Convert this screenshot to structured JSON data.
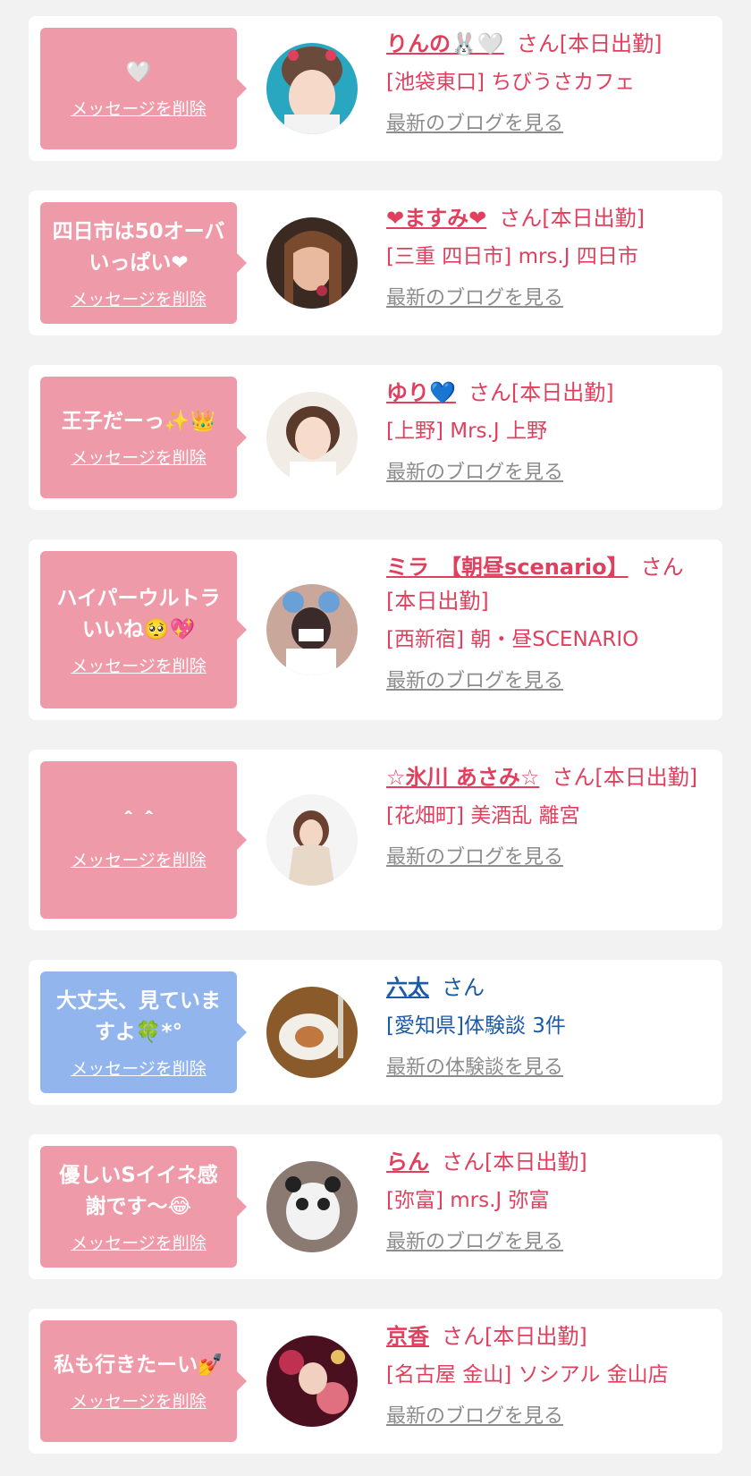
{
  "cards": [
    {
      "message": "🤍",
      "delete_label": "メッセージを削除",
      "name": "りんの🐰🤍",
      "suffix": "さん[本日出勤]",
      "shop": "[池袋東口] ちびうさカフェ",
      "blog_link": "最新のブログを見る"
    },
    {
      "message": "四日市は50オーバ\nいっぱい❤",
      "delete_label": "メッセージを削除",
      "name": "❤ますみ❤",
      "suffix": "さん[本日出勤]",
      "shop": "[三重 四日市] mrs.J 四日市",
      "blog_link": "最新のブログを見る"
    },
    {
      "message": "王子だーっ✨👑",
      "delete_label": "メッセージを削除",
      "name": "ゆり💙",
      "suffix": "さん[本日出勤]",
      "shop": "[上野] Mrs.J 上野",
      "blog_link": "最新のブログを見る"
    },
    {
      "message": "ハイパーウルトラ\nいいね🥺💖",
      "delete_label": "メッセージを削除",
      "name": "ミラ　【朝昼scenario】",
      "suffix": "さん[本日出勤]",
      "shop": "[西新宿] 朝・昼SCENARIO",
      "blog_link": "最新のブログを見る"
    },
    {
      "message": "＾＾",
      "delete_label": "メッセージを削除",
      "name": "☆氷川 あさみ☆",
      "suffix": "さん[本日出勤]",
      "shop": "[花畑町] 美酒乱 離宮",
      "blog_link": "最新のブログを見る"
    },
    {
      "message": "大丈夫、見ていま\nすよ🍀*°",
      "delete_label": "メッセージを削除",
      "name": "六太",
      "suffix": "さん",
      "shop": "[愛知県]体験談 3件",
      "blog_link": "最新の体験談を見る"
    },
    {
      "message": "優しいSイイネ感\n謝です〜😂",
      "delete_label": "メッセージを削除",
      "name": "らん",
      "suffix": "さん[本日出勤]",
      "shop": "[弥富] mrs.J 弥富",
      "blog_link": "最新のブログを見る"
    },
    {
      "message": "私も行きたーい💅",
      "delete_label": "メッセージを削除",
      "name": "京香",
      "suffix": "さん[本日出勤]",
      "shop": "[名古屋 金山] ソシアル 金山店",
      "blog_link": "最新のブログを見る"
    }
  ],
  "colors": {
    "bubble_pink": "#ef9aa8",
    "bubble_blue": "#92b5ee",
    "name_pink": "#e0405e",
    "name_blue": "#1d5aa6",
    "link_gray": "#8c8c8c"
  }
}
